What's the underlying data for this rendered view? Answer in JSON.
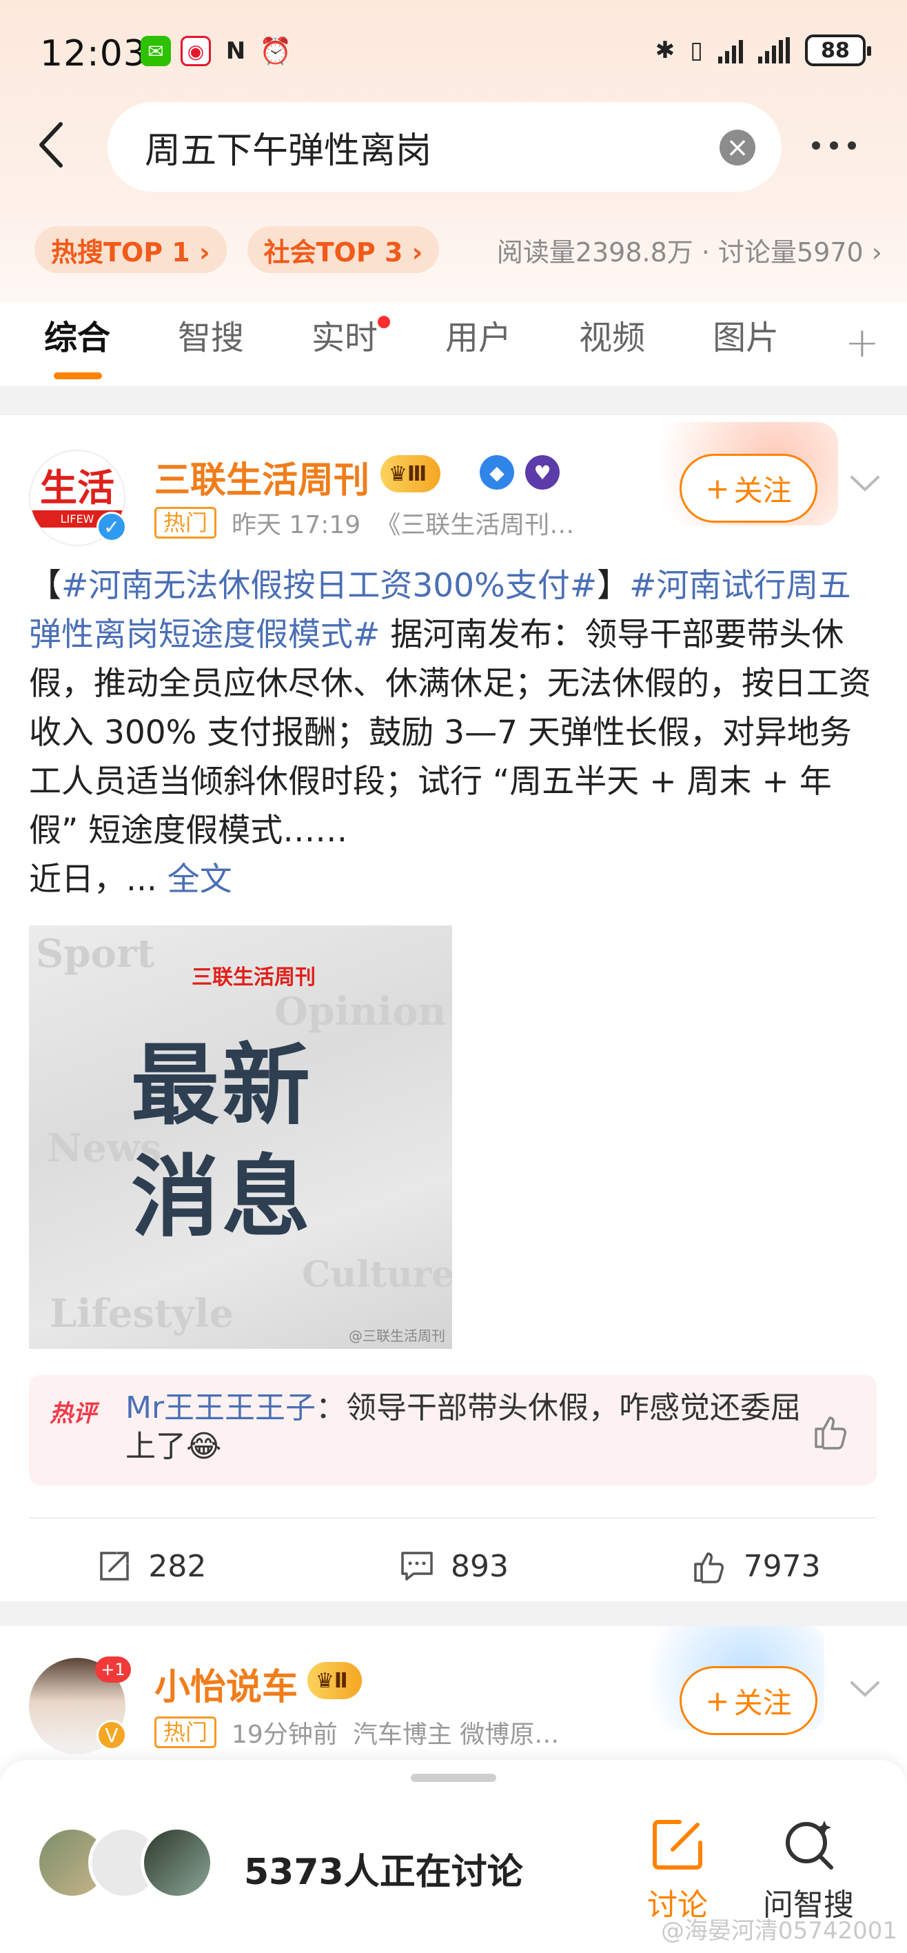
{
  "status_bar": {
    "time": "12:03",
    "battery": "88",
    "left_icons": [
      "wechat-icon",
      "weibo-icon",
      "nfc-icon",
      "alarm-icon"
    ],
    "right_icons": [
      "bluetooth-icon",
      "vibrate-icon",
      "signal-icon",
      "signal-icon",
      "battery-icon"
    ]
  },
  "search": {
    "query": "周五下午弹性离岗"
  },
  "tags": {
    "hot_search": "热搜TOP 1 ›",
    "society": "社会TOP 3 ›",
    "stats": "阅读量2398.8万 · 讨论量5970 ›"
  },
  "tabs": [
    "综合",
    "智搜",
    "实时",
    "用户",
    "视频",
    "图片"
  ],
  "post1": {
    "author": "三联生活周刊",
    "medal_level": "Ⅲ",
    "avatar_text": "生活",
    "avatar_sub": "LIFEW",
    "hot_label": "热门",
    "time": "昨天 17:19",
    "source": "《三联生活周刊…",
    "follow_label": "关注",
    "text_part1": "【",
    "tag1": "#河南无法休假按日工资300%支付#",
    "text_part2": "】",
    "tag2": "#河南试行周五弹性离岗短途度假模式#",
    "body": " 据河南发布：领导干部要带头休假，推动全员应休尽休、休满休足；无法休假的，按日工资收入 300% 支付报酬；鼓励 3—7 天弹性长假，对异地务工人员适当倾斜休假时段；试行 “周五半天 + 周末 + 年假” 短途度假模式……",
    "body2": "近日，... ",
    "full_text_link": "全文",
    "image": {
      "brand": "三联生活周刊",
      "line1": "最新",
      "line2": "消息",
      "words": [
        "Sport",
        "Opinion",
        "News",
        "Culture",
        "Lifestyle"
      ],
      "watermark": "@三联生活周刊"
    },
    "hot_comment_label": "热评",
    "comment_user": "Mr王王王王子",
    "comment_text": "：领导干部带头休假，咋感觉还委屈上了😂",
    "reposts": "282",
    "comments": "893",
    "likes": "7973"
  },
  "post2": {
    "author": "小怡说车",
    "medal_level": "Ⅱ",
    "hot_label": "热门",
    "time": "19分钟前",
    "desc": "汽车博主 微博原…",
    "follow_label": "关注",
    "notif_count": "+1"
  },
  "bottom_sheet": {
    "discussing": "5373人正在讨论",
    "discuss_label": "讨论",
    "ask_label": "问智搜"
  },
  "watermark": "@海晏河清05742001",
  "colors": {
    "accent": "#ff8200",
    "name_orange": "#f07d1b",
    "link_blue": "#4a6fb5"
  }
}
